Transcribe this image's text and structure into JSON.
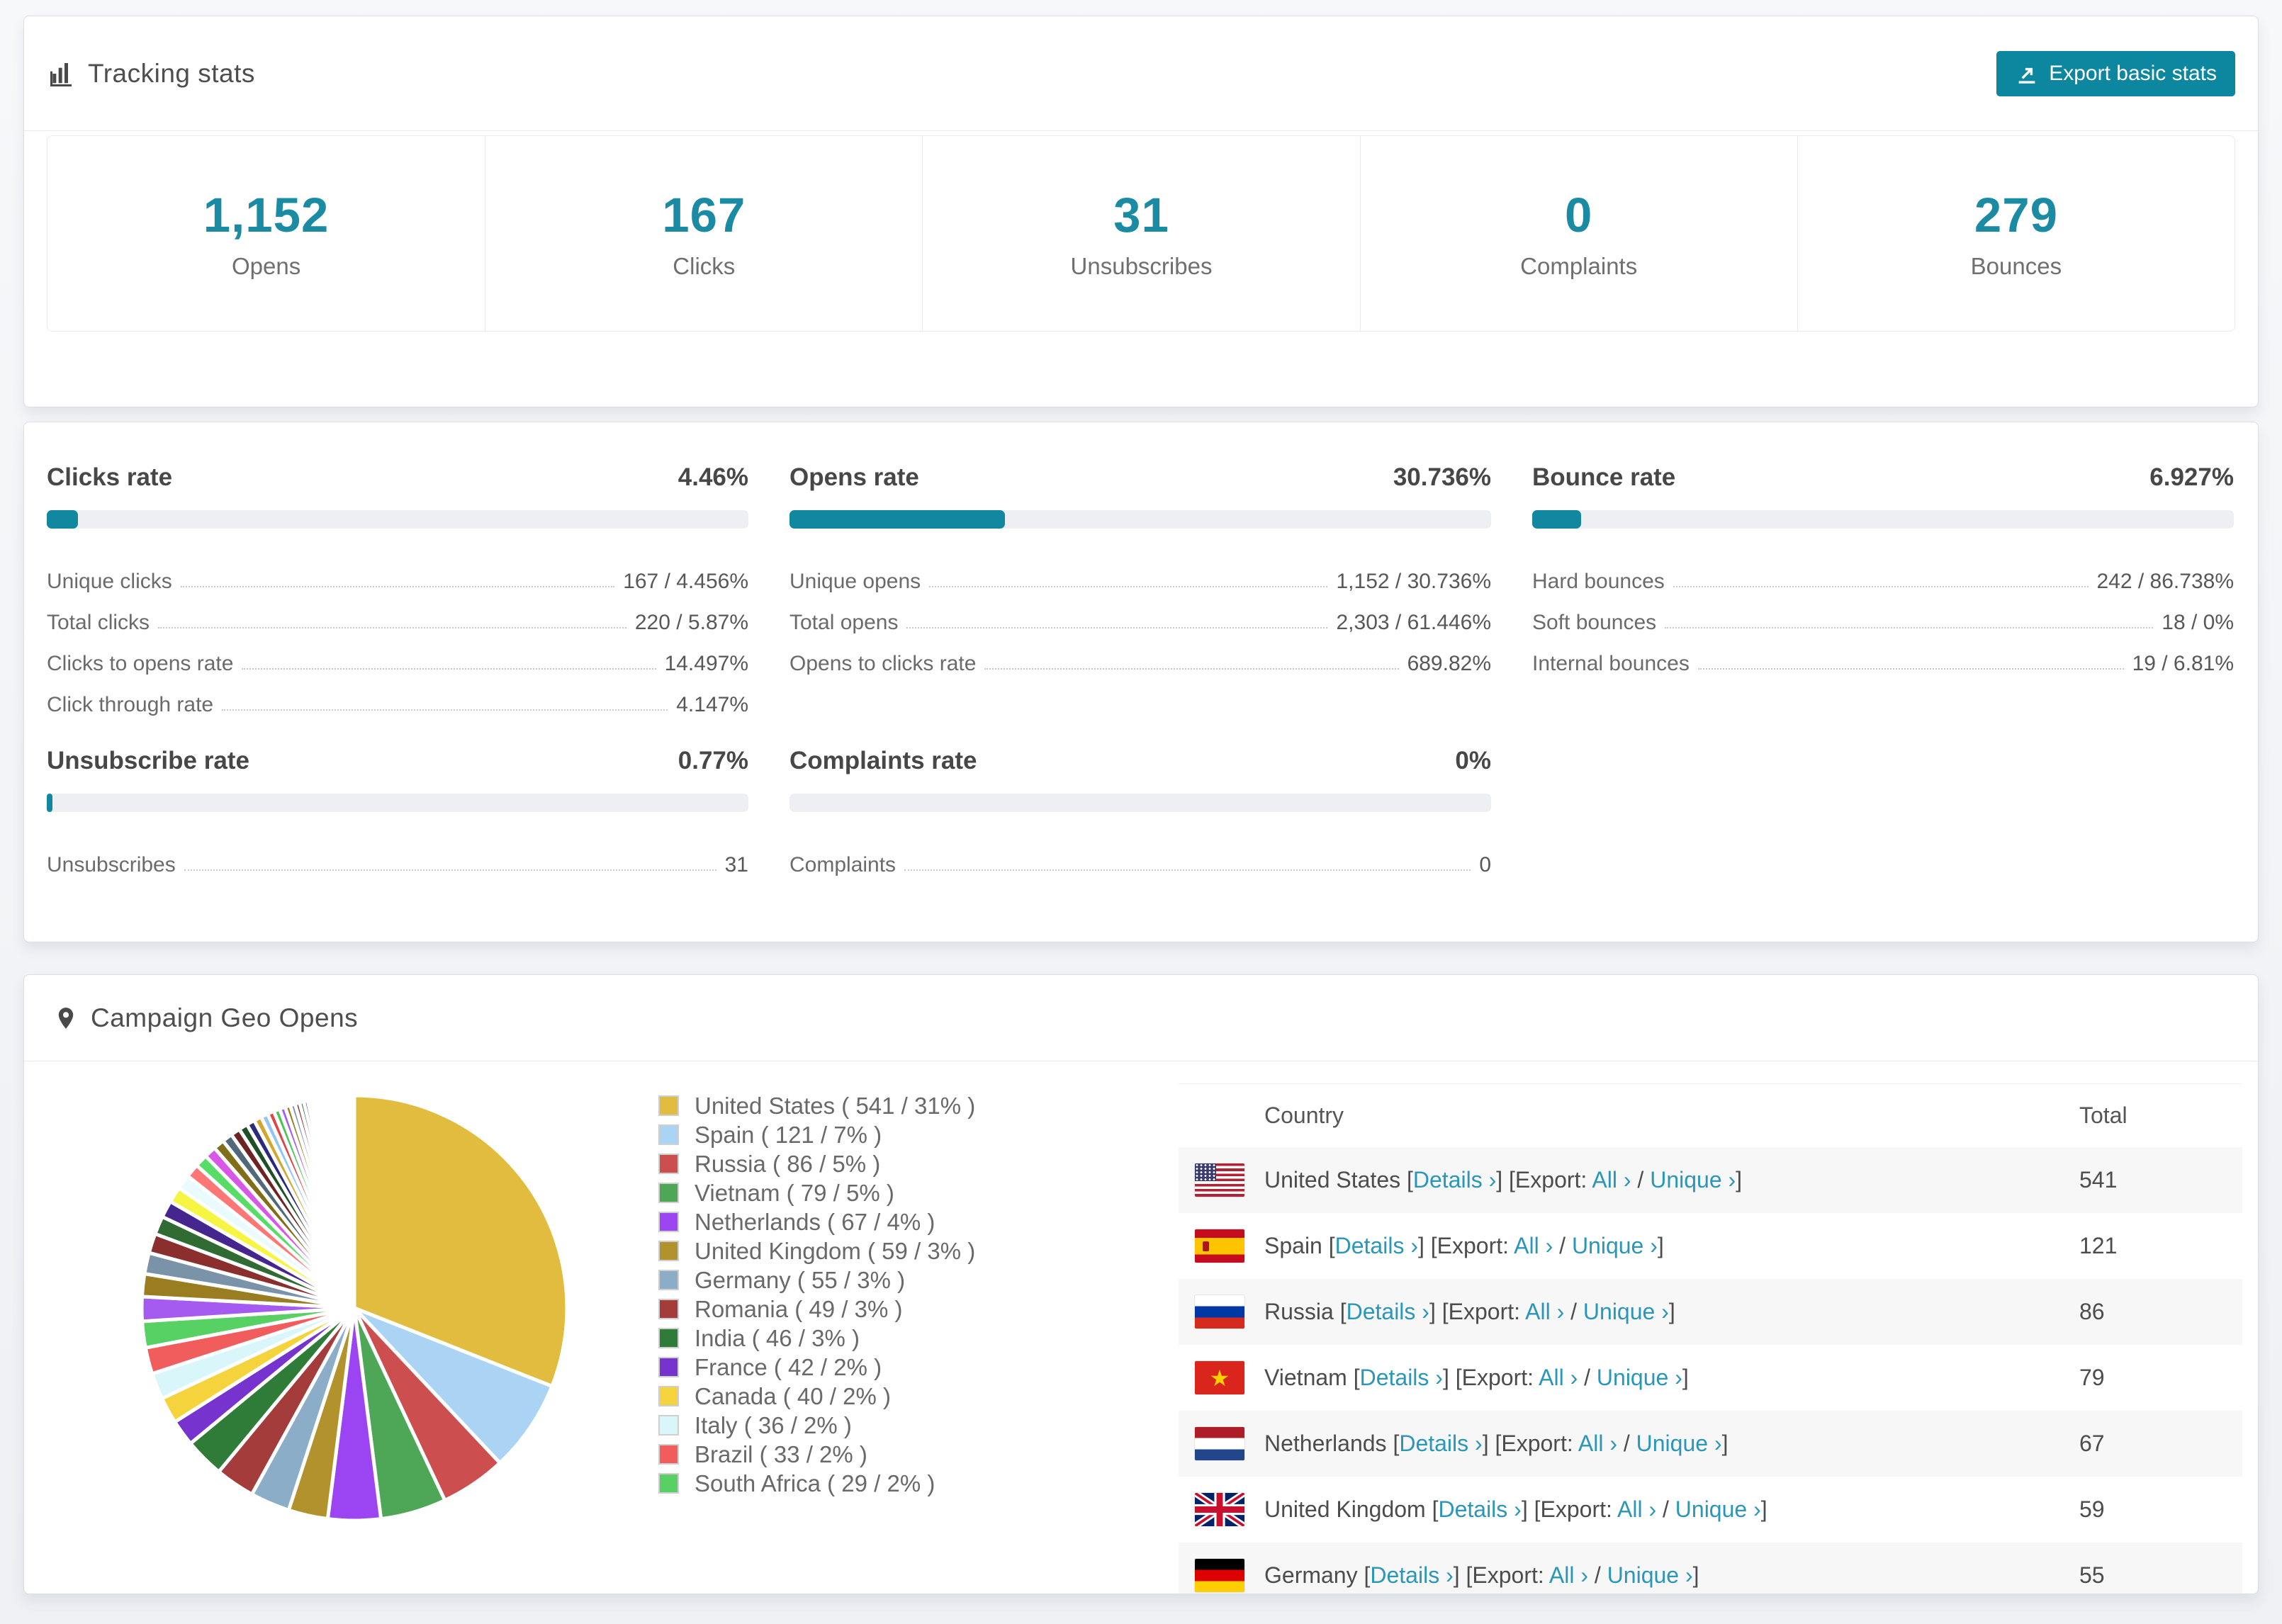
{
  "page": {
    "accent": "#1b8ba4",
    "button_color": "#0d86a0",
    "link_color": "#2a96b8"
  },
  "tracking": {
    "title": "Tracking stats",
    "export_button": "Export basic stats",
    "stats": [
      {
        "value": "1,152",
        "label": "Opens"
      },
      {
        "value": "167",
        "label": "Clicks"
      },
      {
        "value": "31",
        "label": "Unsubscribes"
      },
      {
        "value": "0",
        "label": "Complaints"
      },
      {
        "value": "279",
        "label": "Bounces"
      }
    ]
  },
  "rates": {
    "blocks": [
      {
        "title": "Clicks rate",
        "value": "4.46%",
        "percent": 4.46,
        "rows": [
          {
            "label": "Unique clicks",
            "value": "167 / 4.456%"
          },
          {
            "label": "Total clicks",
            "value": "220 / 5.87%"
          },
          {
            "label": "Clicks to opens rate",
            "value": "14.497%"
          },
          {
            "label": "Click through rate",
            "value": "4.147%"
          }
        ]
      },
      {
        "title": "Opens rate",
        "value": "30.736%",
        "percent": 30.736,
        "rows": [
          {
            "label": "Unique opens",
            "value": "1,152 / 30.736%"
          },
          {
            "label": "Total opens",
            "value": "2,303 / 61.446%"
          },
          {
            "label": "Opens to clicks rate",
            "value": "689.82%"
          }
        ]
      },
      {
        "title": "Bounce rate",
        "value": "6.927%",
        "percent": 6.927,
        "rows": [
          {
            "label": "Hard bounces",
            "value": "242 / 86.738%"
          },
          {
            "label": "Soft bounces",
            "value": "18 / 0%"
          },
          {
            "label": "Internal bounces",
            "value": "19 / 6.81%"
          }
        ]
      },
      {
        "title": "Unsubscribe rate",
        "value": "0.77%",
        "percent": 0.77,
        "rows": [
          {
            "label": "Unsubscribes",
            "value": "31"
          }
        ]
      },
      {
        "title": "Complaints rate",
        "value": "0%",
        "percent": 0,
        "rows": [
          {
            "label": "Complaints",
            "value": "0"
          }
        ]
      }
    ]
  },
  "geo": {
    "title": "Campaign Geo Opens",
    "table": {
      "headers": {
        "country": "Country",
        "total": "Total"
      },
      "link_labels": {
        "details": "Details ›",
        "export": "Export:",
        "all": "All ›",
        "unique": "Unique ›"
      },
      "punct": {
        "p1": " [",
        "p2": "] [",
        "p3": " ",
        "p4": " / ",
        "p5": "]"
      },
      "rows": [
        {
          "flag": "us",
          "country": "United States",
          "total": "541"
        },
        {
          "flag": "es",
          "country": "Spain",
          "total": "121"
        },
        {
          "flag": "ru",
          "country": "Russia",
          "total": "86"
        },
        {
          "flag": "vn",
          "country": "Vietnam",
          "total": "79"
        },
        {
          "flag": "nl",
          "country": "Netherlands",
          "total": "67"
        },
        {
          "flag": "gb",
          "country": "United Kingdom",
          "total": "59"
        },
        {
          "flag": "de",
          "country": "Germany",
          "total": "55"
        }
      ]
    }
  },
  "chart_data": {
    "type": "pie",
    "title": "Campaign Geo Opens",
    "legend_position": "right",
    "start_angle_deg": -90,
    "direction": "clockwise",
    "series": [
      {
        "name": "United States",
        "value": 541,
        "percent": 31,
        "color": "#e2bc3e",
        "label": "United States ( 541 / 31% )"
      },
      {
        "name": "Spain",
        "value": 121,
        "percent": 7,
        "color": "#abd4f4",
        "label": "Spain ( 121 / 7% )"
      },
      {
        "name": "Russia",
        "value": 86,
        "percent": 5,
        "color": "#cc4e4e",
        "label": "Russia ( 86 / 5% )"
      },
      {
        "name": "Vietnam",
        "value": 79,
        "percent": 5,
        "color": "#4ea757",
        "label": "Vietnam ( 79 / 5% )"
      },
      {
        "name": "Netherlands",
        "value": 67,
        "percent": 4,
        "color": "#9b44f2",
        "label": "Netherlands ( 67 / 4% )"
      },
      {
        "name": "United Kingdom",
        "value": 59,
        "percent": 3,
        "color": "#b2922c",
        "label": "United Kingdom ( 59 / 3% )"
      },
      {
        "name": "Germany",
        "value": 55,
        "percent": 3,
        "color": "#8cadc8",
        "label": "Germany ( 55 / 3% )"
      },
      {
        "name": "Romania",
        "value": 49,
        "percent": 3,
        "color": "#a43c3c",
        "label": "Romania ( 49 / 3% )"
      },
      {
        "name": "India",
        "value": 46,
        "percent": 3,
        "color": "#2f7c39",
        "label": "India ( 46 / 3% )"
      },
      {
        "name": "France",
        "value": 42,
        "percent": 2,
        "color": "#7633cd",
        "label": "France ( 42 / 2% )"
      },
      {
        "name": "Canada",
        "value": 40,
        "percent": 2,
        "color": "#f5d33d",
        "label": "Canada ( 40 / 2% )"
      },
      {
        "name": "Italy",
        "value": 36,
        "percent": 2,
        "color": "#d9f7fb",
        "label": "Italy ( 36 / 2% )"
      },
      {
        "name": "Brazil",
        "value": 33,
        "percent": 2,
        "color": "#f15d5d",
        "label": "Brazil ( 33 / 2% )"
      },
      {
        "name": "South Africa",
        "value": 29,
        "percent": 2,
        "color": "#57d163",
        "label": "South Africa ( 29 / 2% )"
      }
    ],
    "unlabeled_remainder_percent": 26,
    "tail_slice_count": 55,
    "tail_decay": 0.93,
    "tail_palette": [
      "#a55bf0",
      "#9a7d20",
      "#7b93a8",
      "#8a2e2e",
      "#2f6b33",
      "#45268f",
      "#f5f542",
      "#e9fbff",
      "#ff7676",
      "#57dd66",
      "#d957e8",
      "#806e19",
      "#50687a",
      "#6f2222",
      "#1f4f24",
      "#2b2b7d",
      "#d2a72e",
      "#92c5f2",
      "#df4545",
      "#49c654"
    ]
  }
}
